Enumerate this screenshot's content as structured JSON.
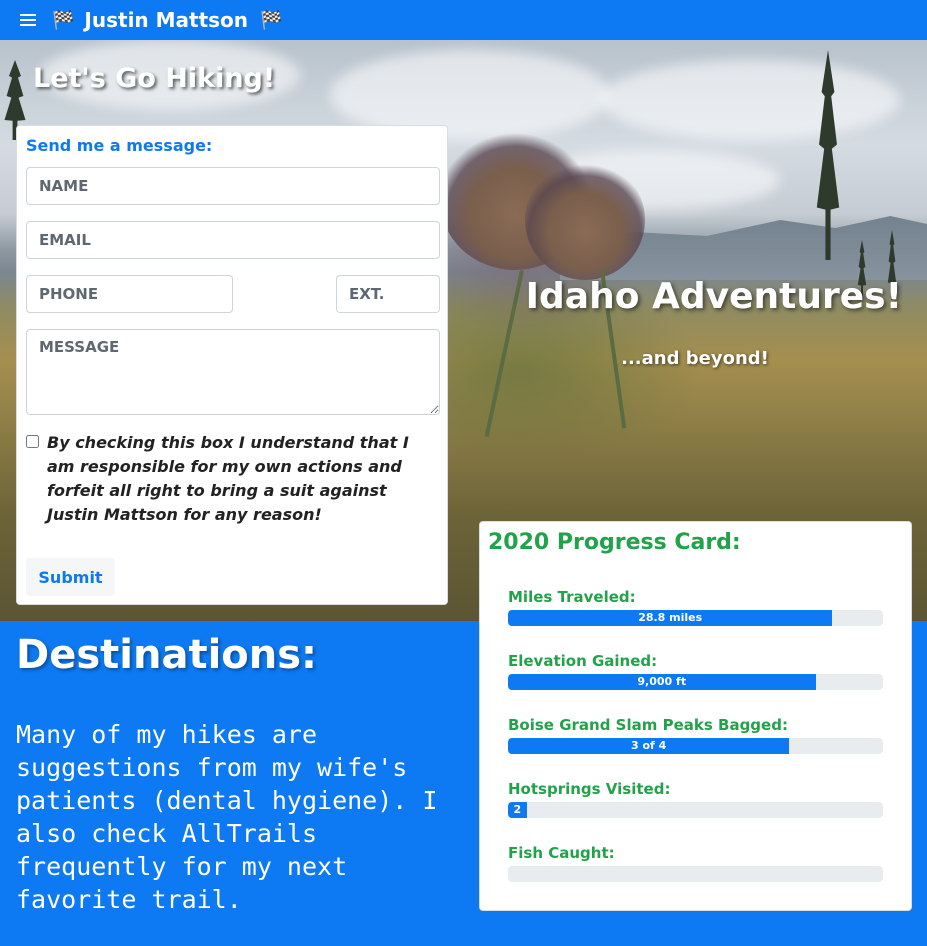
{
  "navbar": {
    "menu_icon": "hamburger-menu-icon",
    "flag_icon": "🏁",
    "title": "Justin Mattson"
  },
  "hero": {
    "heading": "Let's Go Hiking!",
    "title": "Idaho Adventures!",
    "subtitle": "...and beyond!"
  },
  "form": {
    "legend": "Send me a message:",
    "name_placeholder": "NAME",
    "email_placeholder": "EMAIL",
    "phone_placeholder": "PHONE",
    "ext_placeholder": "EXT.",
    "message_placeholder": "MESSAGE",
    "agreement": "By checking this box I understand that I am responsible for my own actions and forfeit all right to bring a suit against Justin Mattson for any reason!",
    "agreement_checked": false,
    "submit_label": "Submit"
  },
  "destinations": {
    "title": "Destinations:",
    "body": "Many of my hikes are suggestions from my wife's patients (dental hygiene). I also check AllTrails frequently for my next favorite trail."
  },
  "progress": {
    "title": "2020 Progress Card:",
    "metrics": [
      {
        "label": "Miles Traveled:",
        "bar_text": "28.8 miles",
        "fraction": 0.865
      },
      {
        "label": "Elevation Gained:",
        "bar_text": "9,000 ft",
        "fraction": 0.82
      },
      {
        "label": "Boise Grand Slam Peaks Bagged:",
        "bar_text": "3 of 4",
        "fraction": 0.75
      },
      {
        "label": "Hotsprings Visited:",
        "bar_text": "2",
        "fraction": 0.05
      },
      {
        "label": "Fish Caught:",
        "bar_text": "",
        "fraction": 0
      }
    ]
  },
  "colors": {
    "primary_blue": "#0d79f2",
    "progress_green": "#22a24a",
    "track_gray": "#e9ecef"
  }
}
